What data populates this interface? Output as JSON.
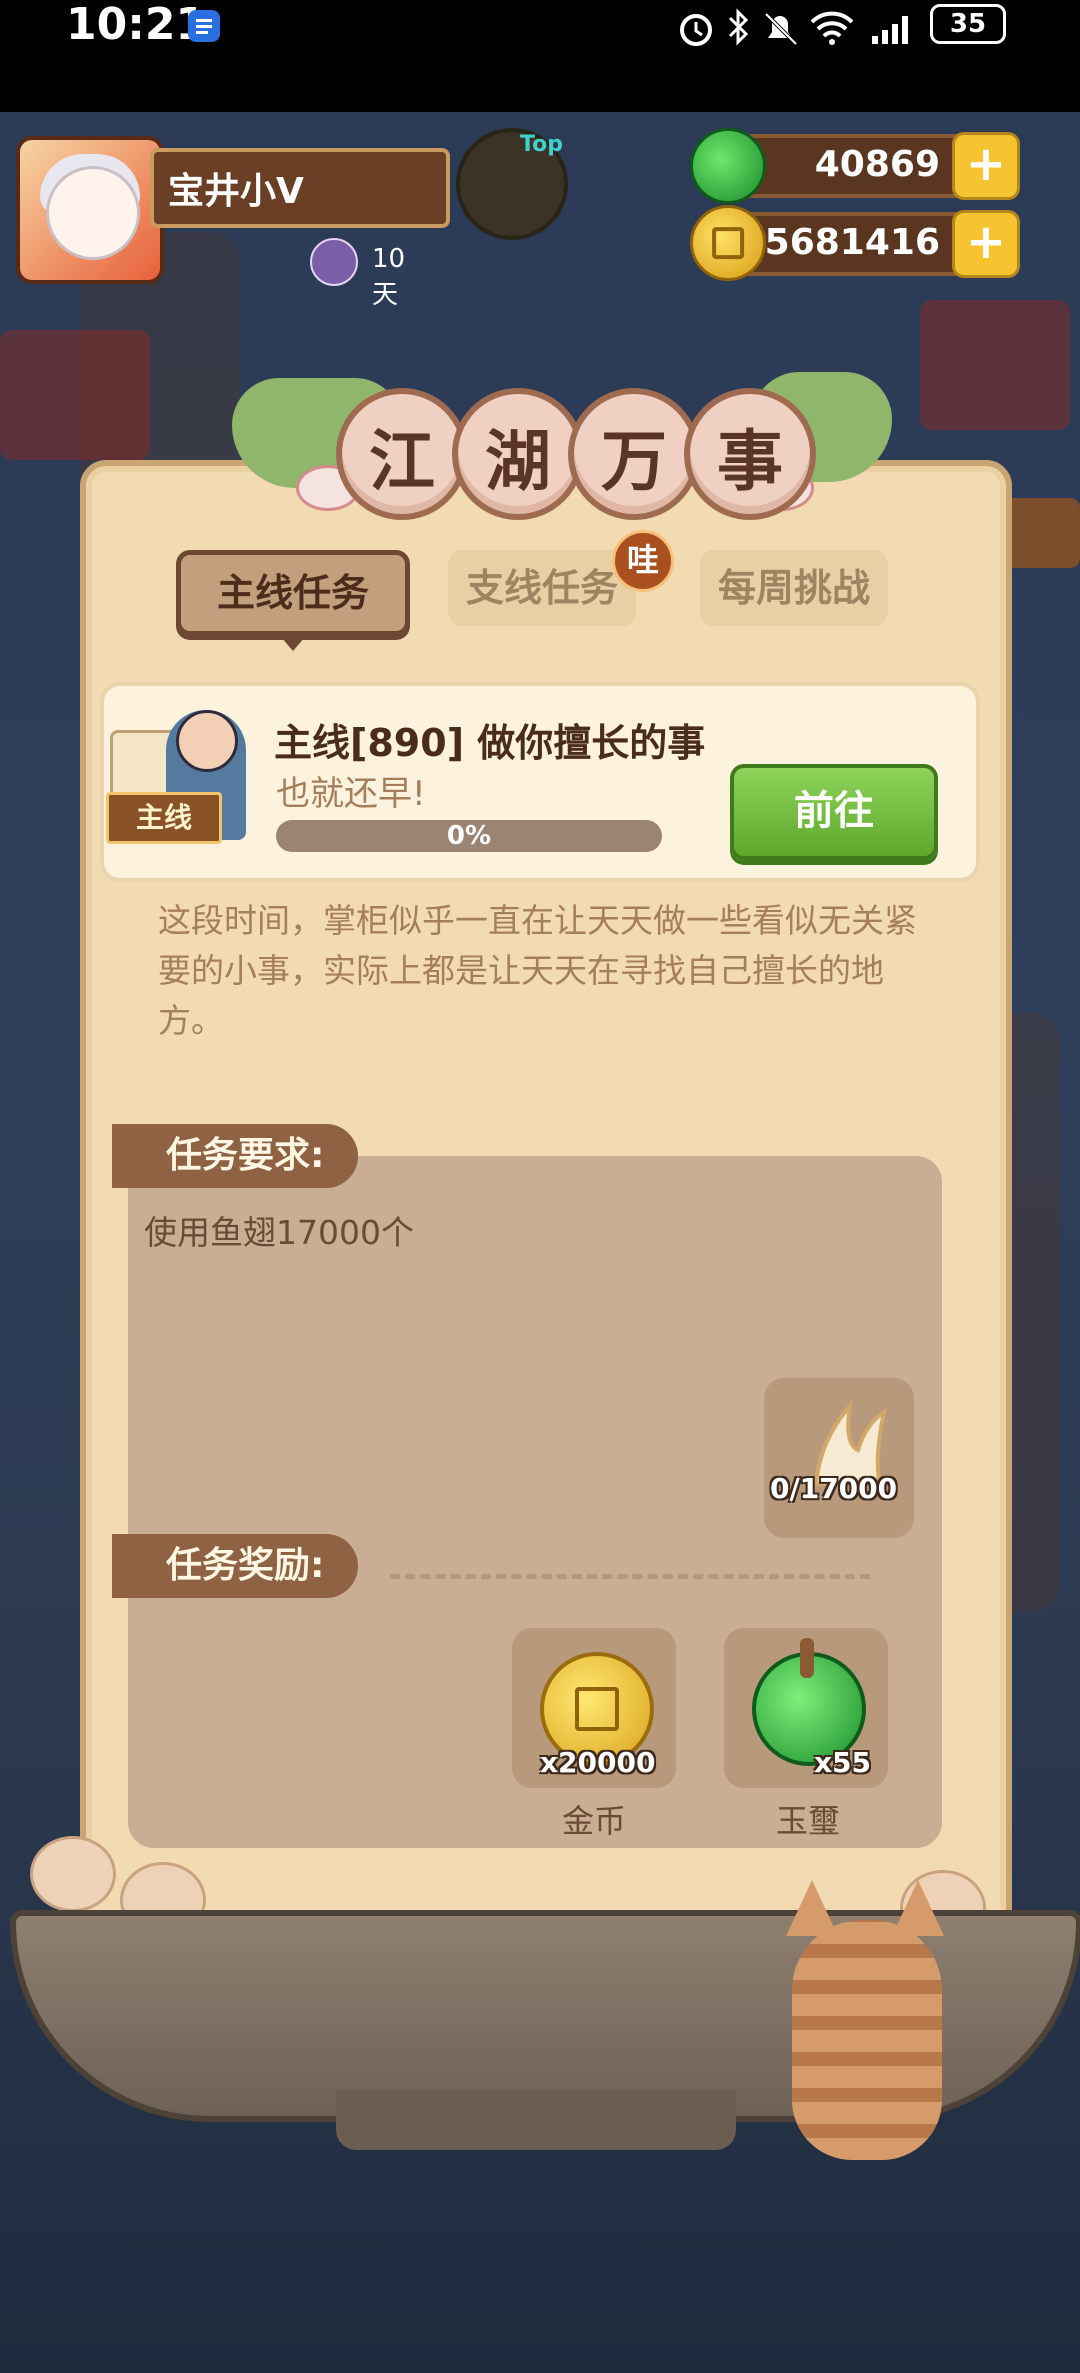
{
  "status_bar": {
    "time": "10:21",
    "battery": "35",
    "icons": [
      "app-notification-icon",
      "alarm-icon",
      "bluetooth-icon",
      "mute-icon",
      "wifi-icon",
      "signal-icon",
      "battery-icon"
    ]
  },
  "hud": {
    "player_name": "宝井小V",
    "days": "10天",
    "top_badge": "Top",
    "jade_amount": "40869",
    "coin_amount": "75681416",
    "plus_symbol": "+"
  },
  "panel": {
    "title_chars": [
      "江",
      "湖",
      "万",
      "事"
    ],
    "tabs": [
      {
        "label": "主线任务",
        "active": true
      },
      {
        "label": "支线任务",
        "active": false
      },
      {
        "label": "每周挑战",
        "active": false
      }
    ],
    "badge": "哇",
    "quest": {
      "tag": "主线",
      "title": "主线[890] 做你擅长的事",
      "subtitle": "也就还早!",
      "progress_text": "0%",
      "progress": 0,
      "go_button": "前往"
    },
    "description": "这段时间，掌柜似乎一直在让天天做一些看似无关紧要的小事，实际上都是让天天在寻找自己擅长的地方。",
    "requirement": {
      "label": "任务要求:",
      "text": "使用鱼翅17000个",
      "item_count": "0/17000"
    },
    "reward": {
      "label": "任务奖励:",
      "items": [
        {
          "name": "金币",
          "count": "x20000"
        },
        {
          "name": "玉璽",
          "count": "x55"
        }
      ]
    }
  },
  "colors": {
    "panel_bg": "#f2dbb3",
    "tab_active": "#c39f7e",
    "go_button": "#5ea82c",
    "section_label": "#8e6243"
  }
}
